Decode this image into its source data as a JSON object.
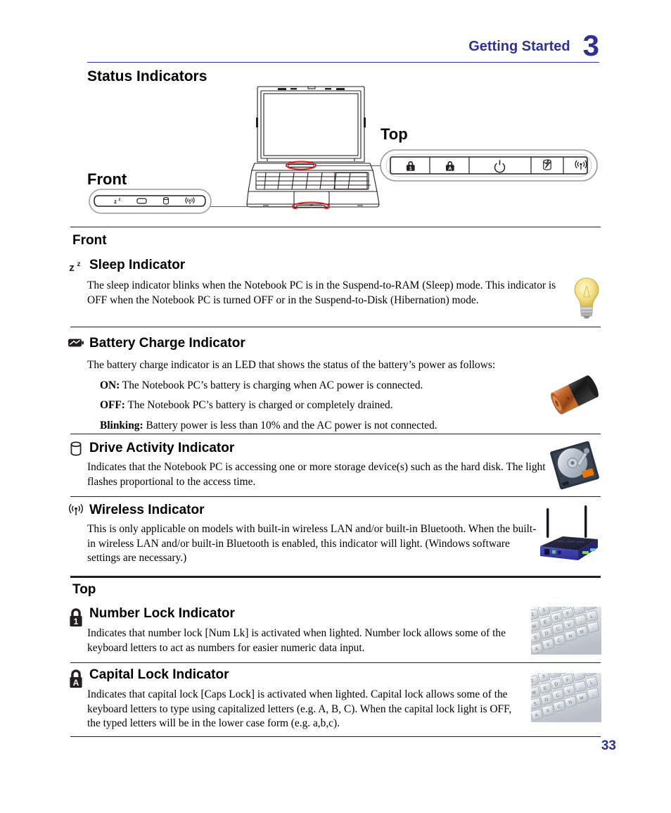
{
  "header": {
    "title": "Getting Started",
    "chapter": "3",
    "accent_color": "#2e3192"
  },
  "page_title": "Status Indicators",
  "diagram": {
    "label_top": "Top",
    "label_front": "Front",
    "top_panel_icons": [
      "number-lock-icon",
      "capital-lock-icon",
      "power-icon",
      "drive-activity-icon",
      "wireless-icon"
    ],
    "front_panel_icons": [
      "sleep-icon",
      "battery-icon",
      "drive-activity-icon",
      "wireless-icon"
    ]
  },
  "sections": [
    {
      "group_label": "Front",
      "icon": "sleep-zz-icon",
      "heading": "Sleep Indicator",
      "body": "The sleep indicator blinks when the Notebook PC is in the Suspend-to-RAM (Sleep) mode. This indicator is OFF when the Notebook PC is turned OFF or in the Suspend-to-Disk (Hibernation) mode.",
      "photo": "lightbulb-photo"
    },
    {
      "icon": "battery-charge-icon",
      "heading": "Battery Charge Indicator",
      "body": "The battery charge indicator is an LED that shows the status of the battery’s power as follows:",
      "items": [
        {
          "term": "ON:",
          "text": "The Notebook PC’s battery is charging when AC power is connected."
        },
        {
          "term": "OFF:",
          "text": "The Notebook PC’s battery is charged or completely drained."
        },
        {
          "term": "Blinking:",
          "text": "Battery power is less than 10% and the AC power is not connected."
        }
      ],
      "photo": "battery-photo"
    },
    {
      "icon": "drive-activity-icon",
      "heading": "Drive Activity Indicator",
      "body": "Indicates that the Notebook PC is accessing one or more storage device(s) such as the hard disk. The light flashes proportional to the access time.",
      "photo": "harddisk-photo"
    },
    {
      "icon": "wireless-icon",
      "heading": "Wireless Indicator",
      "body": "This is only applicable on models with built-in wireless LAN and/or built-in Bluetooth. When the built-in wireless LAN and/or built-in Bluetooth is enabled, this indicator will light. (Windows software settings are necessary.)",
      "photo": "router-photo"
    },
    {
      "group_label": "Top",
      "icon": "number-lock-icon",
      "heading": "Number Lock Indicator",
      "body": "Indicates that number lock [Num Lk] is activated when lighted. Number lock allows some of the  keyboard letters to act as numbers for easier numeric data input.",
      "photo": "keyboard-photo"
    },
    {
      "icon": "capital-lock-icon",
      "heading": "Capital Lock Indicator",
      "body": "Indicates that capital lock [Caps Lock] is activated when lighted. Capital lock allows some of the keyboard letters to type using capitalized letters (e.g. A, B, C). When the capital lock light is OFF, the typed letters will be in the lower case form (e.g. a,b,c).",
      "photo": "keyboard-photo"
    }
  ],
  "group_labels": {
    "front": "Front",
    "top": "Top"
  },
  "page_number": "33"
}
